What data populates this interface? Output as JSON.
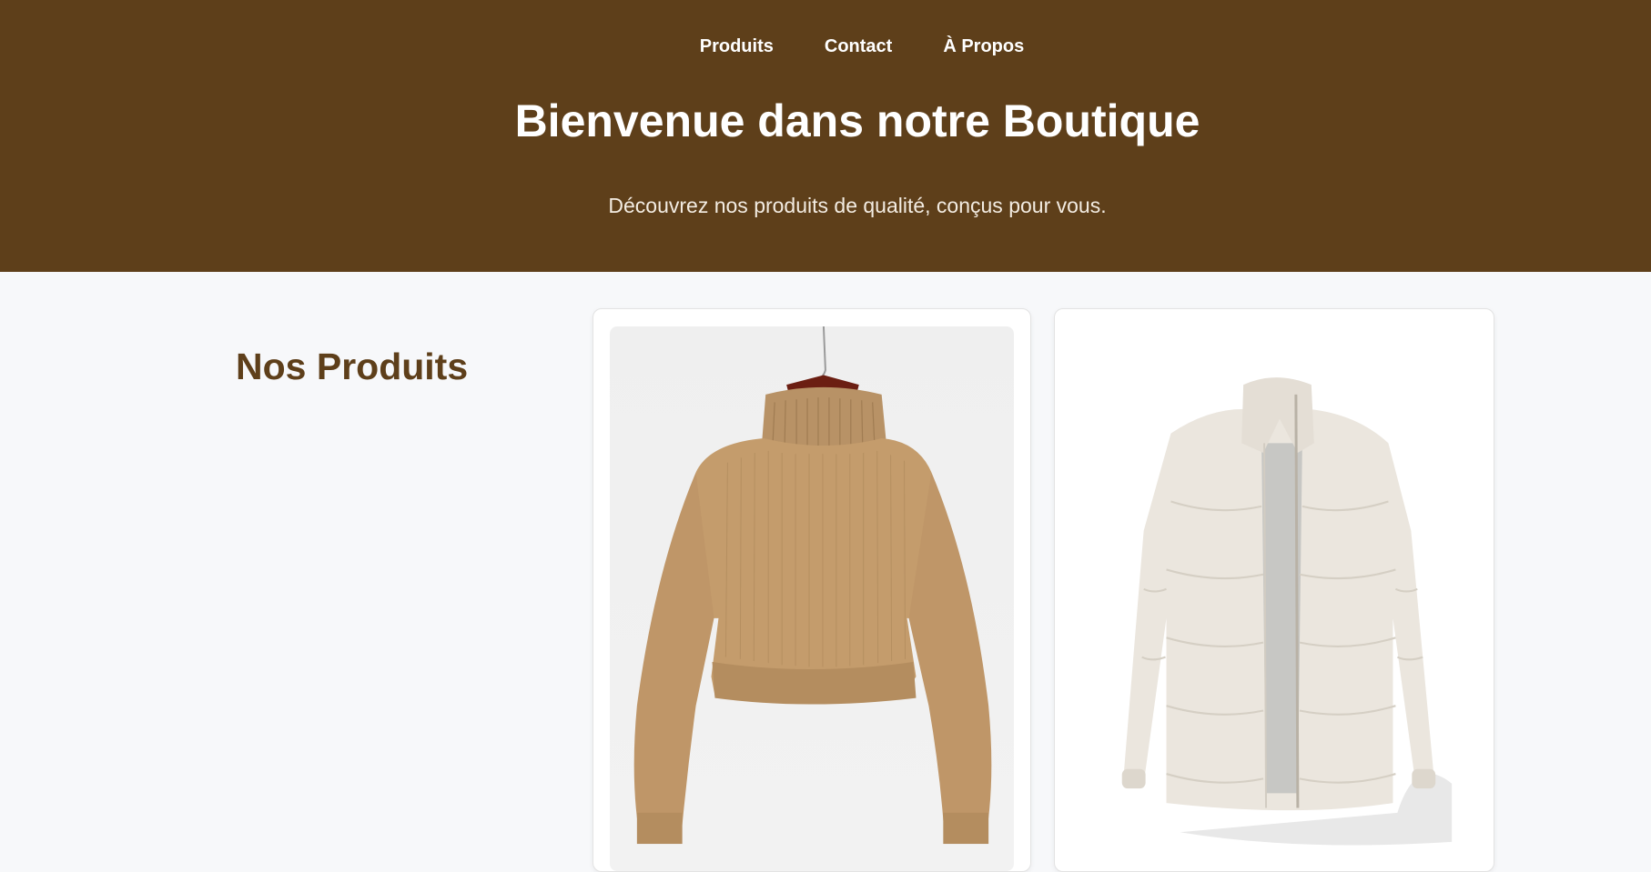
{
  "nav": {
    "items": [
      {
        "label": "Produits"
      },
      {
        "label": "Contact"
      },
      {
        "label": "À Propos"
      }
    ]
  },
  "hero": {
    "title": "Bienvenue dans notre Boutique",
    "subtitle": "Découvrez nos produits de qualité, conçus pour vous."
  },
  "products": {
    "heading": "Nos Produits",
    "items": [
      {
        "image_icon": "sweater-image"
      },
      {
        "image_icon": "puffer-jacket-image"
      }
    ]
  },
  "colors": {
    "brand": "#5e3f1a",
    "background": "#f7f8fa"
  }
}
